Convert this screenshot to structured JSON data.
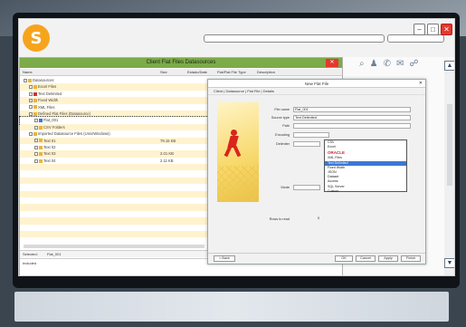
{
  "top": {
    "logo_letter": "S"
  },
  "main_window": {
    "title": "Client Flat Files Datasources",
    "columns": [
      "Name",
      "Size",
      "Estado/Date",
      "Flat/Flat File Type",
      "Description"
    ],
    "rows": [
      {
        "name": "Datasources",
        "size": ""
      },
      {
        "name": "Excel Files",
        "size": ""
      },
      {
        "name": "Text Delimited",
        "size": ""
      },
      {
        "name": "Fixed Width",
        "size": ""
      },
      {
        "name": "XML Files",
        "size": ""
      },
      {
        "name": "Defined Flat Files (Datasource)",
        "size": ""
      },
      {
        "name": "Flat_001",
        "size": ""
      },
      {
        "name": "CSV Folders",
        "size": ""
      },
      {
        "name": "Imported Datasource Files (Unix/Windows)",
        "size": ""
      },
      {
        "name": "Text 01",
        "size": "79.15 KB"
      },
      {
        "name": "Text 02",
        "size": ""
      },
      {
        "name": "Text 03",
        "size": "2.01 KB"
      },
      {
        "name": "Text 04",
        "size": "2.11 KB"
      }
    ],
    "status_label": "Selected:",
    "status_value": "Flat_001",
    "footer_label": "Included"
  },
  "dialog": {
    "title": "New Flat File",
    "breadcrumb": "Client | Datasource | Flat File | Details",
    "fields": [
      {
        "label": "File name",
        "value": "Flat_001"
      },
      {
        "label": "Source type",
        "value": "Text Delimited"
      },
      {
        "label": "Path",
        "value": ""
      },
      {
        "label": "Encoding",
        "value": ""
      },
      {
        "label": "Delimiter",
        "value": ""
      },
      {
        "label": "Mode",
        "value": ""
      }
    ],
    "dropdown_options": [
      "CSV",
      "Excel",
      "ORACLE",
      "XML Files",
      "Text Delimited",
      "Fixed Width",
      "JSON",
      "Dataset",
      "Access",
      "SQL Server",
      "Custom"
    ],
    "dropdown_oracle_brand": "ORACLE",
    "selected_option": "Text Delimited",
    "bottom_field_label": "Rows to read",
    "bottom_field_value": "0",
    "footer_buttons": {
      "left": "< Back",
      "right": [
        "OK",
        "Cancel",
        "Apply",
        "Finish"
      ]
    }
  },
  "colors": {
    "title_bar_green": "#7cab48",
    "row_alt_yellow": "#fff3cf",
    "close_red": "#e4382e",
    "logo_orange": "#f7a41d",
    "selection_blue": "#3a78d4"
  }
}
